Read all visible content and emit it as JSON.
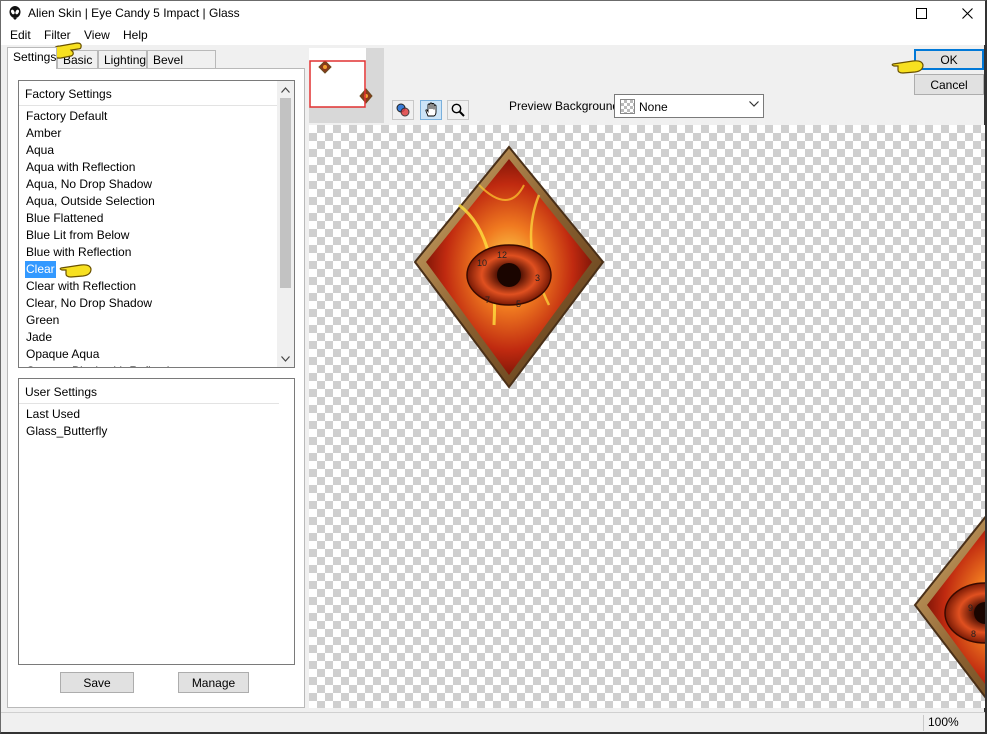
{
  "window": {
    "title": "Alien Skin | Eye Candy 5 Impact | Glass"
  },
  "menu": {
    "items": [
      "Edit",
      "Filter",
      "View",
      "Help"
    ]
  },
  "tabs": [
    {
      "label": "Settings",
      "active": true
    },
    {
      "label": "Basic",
      "active": false
    },
    {
      "label": "Lighting",
      "active": false
    },
    {
      "label": "Bevel Profile",
      "active": false
    }
  ],
  "factory": {
    "header": "Factory Settings",
    "items": [
      "Factory Default",
      "Amber",
      "Aqua",
      "Aqua with Reflection",
      "Aqua, No Drop Shadow",
      "Aqua, Outside Selection",
      "Blue Flattened",
      "Blue Lit from Below",
      "Blue with Reflection",
      "Clear",
      "Clear with Reflection",
      "Clear, No Drop Shadow",
      "Green",
      "Jade",
      "Opaque Aqua",
      "Opaque Black with Reflection"
    ],
    "selected": "Clear"
  },
  "user": {
    "header": "User Settings",
    "items": [
      "Last Used",
      "Glass_Butterfly"
    ]
  },
  "buttons": {
    "save": "Save",
    "manage": "Manage",
    "ok": "OK",
    "cancel": "Cancel"
  },
  "preview": {
    "background_label": "Preview Background:",
    "background_value": "None"
  },
  "status": {
    "zoom": "100%"
  },
  "icons": {
    "app": "alien-head-icon",
    "maximize": "maximize-icon",
    "close": "close-icon",
    "compare": "compare-icon",
    "hand": "hand-icon",
    "zoom": "zoom-icon",
    "pointer": "pointing-hand-icon"
  }
}
